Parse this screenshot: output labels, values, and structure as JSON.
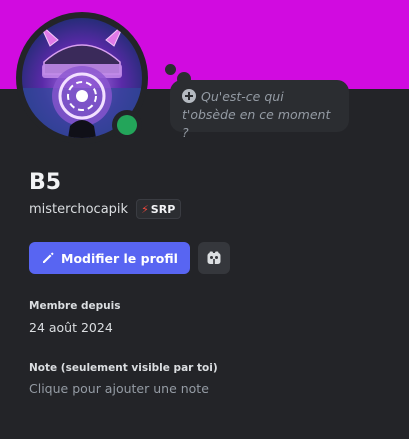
{
  "colors": {
    "banner": "#d10be0",
    "card_background": "#232428",
    "primary_button": "#5865f2",
    "status_online": "#23a55a",
    "badge_bolt": "#f0473c"
  },
  "profile": {
    "display_name": "B5",
    "username": "misterchocapik",
    "status_indicator": "online",
    "custom_status_placeholder": "Qu'est-ce qui t'obsède en ce moment ?",
    "tag": {
      "icon": "lightning-bolt-icon",
      "label": "SRP"
    }
  },
  "actions": {
    "edit_profile_label": "Modifier le profil",
    "edit_icon": "pencil-icon",
    "secondary_icon": "server-tag-icon"
  },
  "member_since": {
    "title": "Membre depuis",
    "value": "24 août 2024"
  },
  "note": {
    "title": "Note (seulement visible par toi)",
    "placeholder": "Clique pour ajouter une note"
  }
}
